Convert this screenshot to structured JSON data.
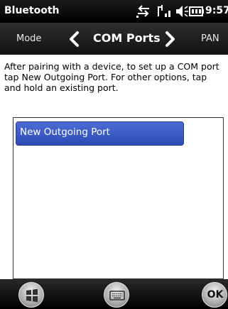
{
  "status_bar": {
    "title": "Bluetooth",
    "time": "9:57",
    "icons": [
      "connectivity-icon",
      "signal-icon",
      "volume-icon",
      "battery-icon"
    ]
  },
  "tab_bar": {
    "left_tab": "Mode",
    "current_tab": "COM Ports",
    "right_tab": "PAN",
    "icons": [
      "chevron-left-icon",
      "chevron-right-icon"
    ]
  },
  "instructions": "After pairing with a device, to set up a COM port tap New Outgoing Port. For other options, tap and hold an existing port.",
  "port_list": {
    "items": [
      "New Outgoing Port"
    ],
    "selected_index": 0
  },
  "bottom_bar": {
    "ok_label": "OK",
    "icons": [
      "windows-start-icon",
      "keyboard-icon"
    ]
  },
  "colors": {
    "selection": "#3556c4",
    "bar_background": "#000000"
  }
}
